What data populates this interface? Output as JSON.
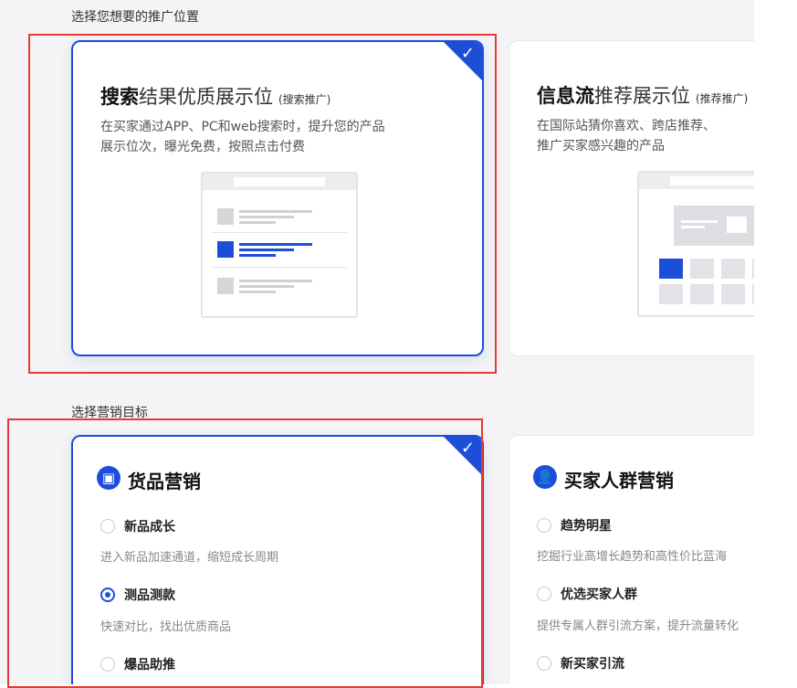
{
  "placement": {
    "section_title": "选择您想要的推广位置",
    "search": {
      "title_bold": "搜索",
      "title_rest": "结果优质展示位",
      "title_small": "(搜索推广)",
      "desc": "在买家通过APP、PC和web搜索时，提升您的产品\n展示位次，曝光免费，按照点击付费",
      "check": "✓"
    },
    "feed": {
      "title_bold": "信息流",
      "title_rest": "推荐展示位",
      "title_small": "(推荐推广)",
      "desc": "在国际站猜你喜欢、跨店推荐、\n推广买家感兴趣的产品"
    }
  },
  "goal": {
    "section_title": "选择营销目标",
    "product": {
      "title": "货品营销",
      "icon": "cube-icon",
      "check": "✓",
      "options": [
        {
          "label": "新品成长",
          "desc": "进入新品加速通道，缩短成长周期",
          "checked": false
        },
        {
          "label": "测品测款",
          "desc": "快速对比，找出优质商品",
          "checked": true
        },
        {
          "label": "爆品助推",
          "desc": "",
          "checked": false
        }
      ]
    },
    "buyer": {
      "title": "买家人群营销",
      "icon": "person-icon",
      "options": [
        {
          "label": "趋势明星",
          "desc": "挖掘行业高增长趋势和高性价比蓝海",
          "checked": false
        },
        {
          "label": "优选买家人群",
          "desc": "提供专属人群引流方案，提升流量转化",
          "checked": false
        },
        {
          "label": "新买家引流",
          "desc": "",
          "checked": false
        }
      ]
    }
  },
  "colors": {
    "accent": "#1d4ed8",
    "highlight_frame": "#e53935"
  }
}
